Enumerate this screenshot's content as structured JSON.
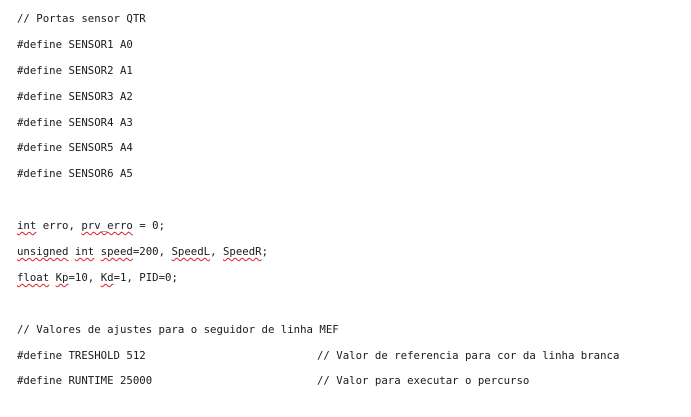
{
  "document": {
    "lines": [
      {
        "text": "// Portas sensor QTR"
      },
      {
        "text": "#define SENSOR1 A0"
      },
      {
        "text": "#define SENSOR2 A1"
      },
      {
        "text": "#define SENSOR3 A2"
      },
      {
        "text": "#define SENSOR4 A3"
      },
      {
        "text": "#define SENSOR5 A4"
      },
      {
        "text": "#define SENSOR6 A5"
      },
      {
        "text": ""
      },
      {
        "text": ""
      },
      {
        "parts": [
          "int",
          " erro, ",
          "prv_erro",
          " = 0;"
        ]
      },
      {
        "parts": [
          "unsigned",
          " ",
          "int",
          " ",
          "speed",
          "=200, ",
          "SpeedL",
          ", ",
          "SpeedR",
          ";"
        ]
      },
      {
        "parts": [
          "float",
          " ",
          "Kp",
          "=10, ",
          "Kd",
          "=1, PID=0;"
        ]
      },
      {
        "text": ""
      },
      {
        "text": "// Valores de ajustes para o seguidor de linha MEF"
      },
      {
        "code": "#define TRESHOLD 512",
        "comment": "// Valor de referencia para cor da linha branca"
      },
      {
        "code": "#define RUNTIME 25000",
        "comment": "// Valor para executar o percurso"
      }
    ]
  },
  "colors": {
    "text": "#1a1a1a",
    "spellcheck_underline": "#dd2222",
    "background": "#ffffff"
  }
}
